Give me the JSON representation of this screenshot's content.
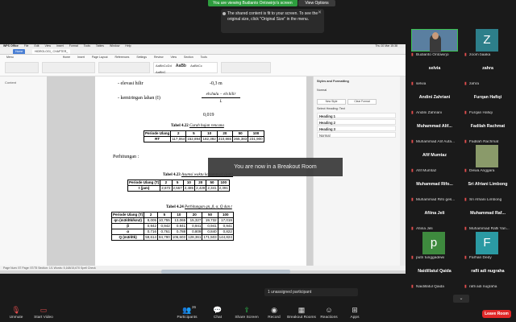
{
  "top": {
    "share_banner": "You are viewing Budianto Ontowirjo's screen",
    "view_options": "View Options",
    "notice_line1": "The shared content is fit to your screen. To see the",
    "notice_line2": "original size, click \"Original Size\" in the menu.",
    "notice_close": "✕"
  },
  "shared": {
    "mac_menu": [
      "WPS Office",
      "File",
      "Edit",
      "View",
      "Insert",
      "Format",
      "Tools",
      "Tables",
      "Window",
      "Help"
    ],
    "mac_right": "Thu 10 Mar 15:38",
    "wps_tab_home": "Home",
    "wps_tab_doc": "HIDROLOGI_ CHAPTER_",
    "menu_items": [
      "Menu",
      "Home",
      "Insert",
      "Page Layout",
      "References",
      "Settings",
      "Review",
      "View",
      "Section",
      "Tools"
    ],
    "styles": [
      "AaBbCcDd",
      "AaBb",
      "AaBbCc",
      "AaBbC"
    ],
    "content_label": "Content",
    "doc": {
      "line1": "- elevasi hilir",
      "val1": "-0,3 m",
      "line2": "- kemiringan lahan (I)",
      "frac_num": "elv.hulu − elv.hilir",
      "frac_den": "L",
      "val2": "0,019",
      "caption1_bold": "Tabel 4.22",
      "caption1_italic": "Curah hujan rencana",
      "t1_header": [
        "Periode Ulang",
        "2",
        "5",
        "10",
        "20",
        "50",
        "100"
      ],
      "t1_row": [
        "RT",
        "117,064",
        "152,894",
        "182,392",
        "210,865",
        "265,383",
        "231,900"
      ],
      "perhitungan": "Perhitungan :",
      "caption2_bold": "Tabel 4.23",
      "caption2_italic": "Asumsi waktu konsentrasi (jam)",
      "t2_header": [
        "Periode Ulang (T)",
        "2",
        "5",
        "10",
        "20",
        "50",
        "100"
      ],
      "t2_row": [
        "t (jam)",
        "2,672",
        "2,557",
        "2,485",
        "2,428",
        "2,341",
        "2,391"
      ],
      "caption3_bold": "Tabel 4.24",
      "caption3_italic": "Perhitungan qn, β, α, Q dan t",
      "t3_header": [
        "Periode Ulang (T)",
        "2",
        "5",
        "10",
        "20",
        "50",
        "100"
      ],
      "t3_rows": [
        [
          "qn (m3/dtk/km2)",
          "8,005",
          "10,755",
          "13,065",
          "15,327",
          "19,732",
          "17,019"
        ],
        [
          "β",
          "0,942",
          "0,942",
          "0,941",
          "0,941",
          "0,941",
          "0,941"
        ],
        [
          "α",
          "0,716",
          "0,761",
          "0,788",
          "0,809",
          "0,840",
          "0,822"
        ],
        [
          "Q (m3/dtk)",
          "59,614",
          "84,790",
          "106,603",
          "128,361",
          "171,503",
          "144,824"
        ]
      ]
    },
    "panel": {
      "title": "Styles and Formatting",
      "normal": "Normal",
      "new_style": "New Style",
      "clear_format": "Clear Format",
      "select_heading": "Select Heading: Text",
      "headings": [
        "Heading 1",
        "Heading 2",
        "Heading 3"
      ],
      "last": "Normal"
    },
    "status": "Page Num: 57   Page: 57/75   Section: 1/1   Words: 5,168/15,670   Spell Check",
    "breakout_banner": "You are now in a Breakout Room"
  },
  "gallery": [
    {
      "name": "",
      "sub": "Budianto Ontowirjo",
      "type": "video"
    },
    {
      "name": "Z",
      "sub": "zoom baaka",
      "type": "avatar",
      "color": "#2d7f8a"
    },
    {
      "name": "selvia",
      "sub": "selvia",
      "type": "name"
    },
    {
      "name": "zahra",
      "sub": "zahra",
      "type": "name"
    },
    {
      "name": "Andini Zahriani",
      "sub": "Andini Zahriani",
      "type": "name"
    },
    {
      "name": "Furqan Hafiqi",
      "sub": "Furqan Hafiqi",
      "type": "name"
    },
    {
      "name": "Muhammad Alif...",
      "sub": "Muhammad Alif Aufa...",
      "type": "name"
    },
    {
      "name": "Fadilah Rachmat",
      "sub": "Fadilah Rachmat",
      "type": "name"
    },
    {
      "name": "Afif Mumtaz",
      "sub": "Afif Mumtaz",
      "type": "name"
    },
    {
      "name": "Dewa Anggara",
      "sub": "Dewa Anggara",
      "type": "photo"
    },
    {
      "name": "Muhammad Rifo...",
      "sub": "Muhammad Rifo ges...",
      "type": "name"
    },
    {
      "name": "Sri Afriani Limbong",
      "sub": "Sri Afriani Limbong",
      "type": "name"
    },
    {
      "name": "Afiina Jeli",
      "sub": "Afiina Jeli",
      "type": "name"
    },
    {
      "name": "Muhammad Raf...",
      "sub": "Muhammad Rafli Yan...",
      "type": "name"
    },
    {
      "name": "p",
      "sub": "putri tunggadewi",
      "type": "avatar",
      "color": "#3e8a3e"
    },
    {
      "name": "F",
      "sub": "Farhan Dedy",
      "type": "avatar",
      "color": "#2b9aa3"
    },
    {
      "name": "Naidillatul Qaida",
      "sub": "Naidillatul Qaida",
      "type": "name"
    },
    {
      "name": "rafli adi nugraha",
      "sub": "rafli adi nugraha",
      "type": "name"
    }
  ],
  "unassigned": "1 unassigned participant",
  "toolbar": {
    "unmute": "Unmute",
    "start_video": "Start Video",
    "participants": "Participants",
    "participants_count": "26",
    "chat": "Chat",
    "share_screen": "Share Screen",
    "record": "Record",
    "breakout_rooms": "Breakout Rooms",
    "reactions": "Reactions",
    "apps": "Apps",
    "leave": "Leave Room"
  },
  "icons": {
    "unmute": "microphone-muted-icon",
    "start_video": "video-off-icon",
    "participants": "people-icon",
    "chat": "chat-icon",
    "share_screen": "share-screen-icon",
    "record": "record-icon",
    "breakout": "breakout-rooms-icon",
    "reactions": "smile-icon",
    "apps": "apps-icon"
  }
}
